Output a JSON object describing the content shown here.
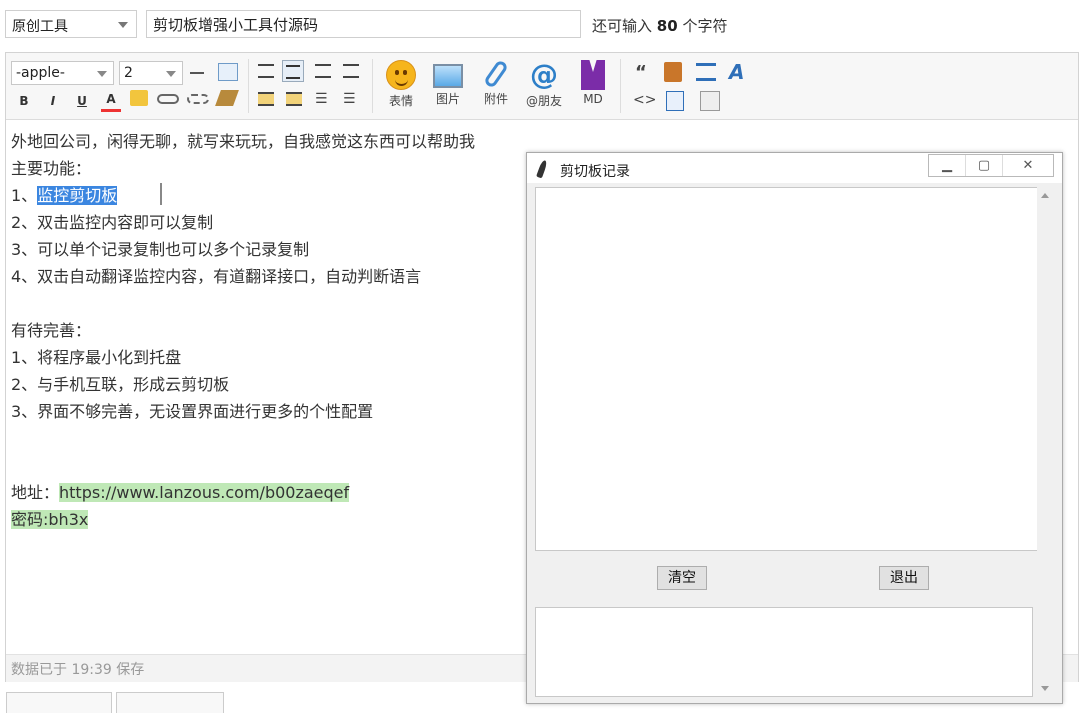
{
  "header": {
    "category": "原创工具",
    "title_value": "剪切板增强小工具付源码",
    "remain_prefix": "还可输入",
    "remain_count": "80",
    "remain_suffix": "个字符"
  },
  "toolbar": {
    "font_family": "-apple-",
    "font_size": "2",
    "emoji_label": "表情",
    "image_label": "图片",
    "attach_label": "附件",
    "mention_label": "@朋友",
    "markdown_label": "MD",
    "bold": "B",
    "italic": "I",
    "underline": "U",
    "font_color": "A",
    "quote": "“",
    "code": "<>"
  },
  "content": {
    "line1": "外地回公司，闲得无聊，就写来玩玩，自我感觉这东西可以帮助我",
    "line2": "主要功能：",
    "line3_prefix": "1、",
    "line3_highlight": "监控剪切板",
    "line4": "2、双击监控内容即可以复制",
    "line5": "3、可以单个记录复制也可以多个记录复制",
    "line6": "4、双击自动翻译监控内容，有道翻译接口，自动判断语言",
    "line7": "有待完善：",
    "line8": "1、将程序最小化到托盘",
    "line9": "2、与手机互联，形成云剪切板",
    "line10": "3、界面不够完善，无设置界面进行更多的个性配置",
    "addr_prefix": "地址：",
    "addr_url": "https://www.lanzous.com/b00zaeqef",
    "password": "密码:bh3x"
  },
  "status": {
    "saved": "数据已于 19:39 保存"
  },
  "dialog": {
    "title": "剪切板记录",
    "clear_button": "清空",
    "exit_button": "退出"
  },
  "colors": {
    "selection": "#3b86e0",
    "link_highlight": "#bfe8b6"
  }
}
